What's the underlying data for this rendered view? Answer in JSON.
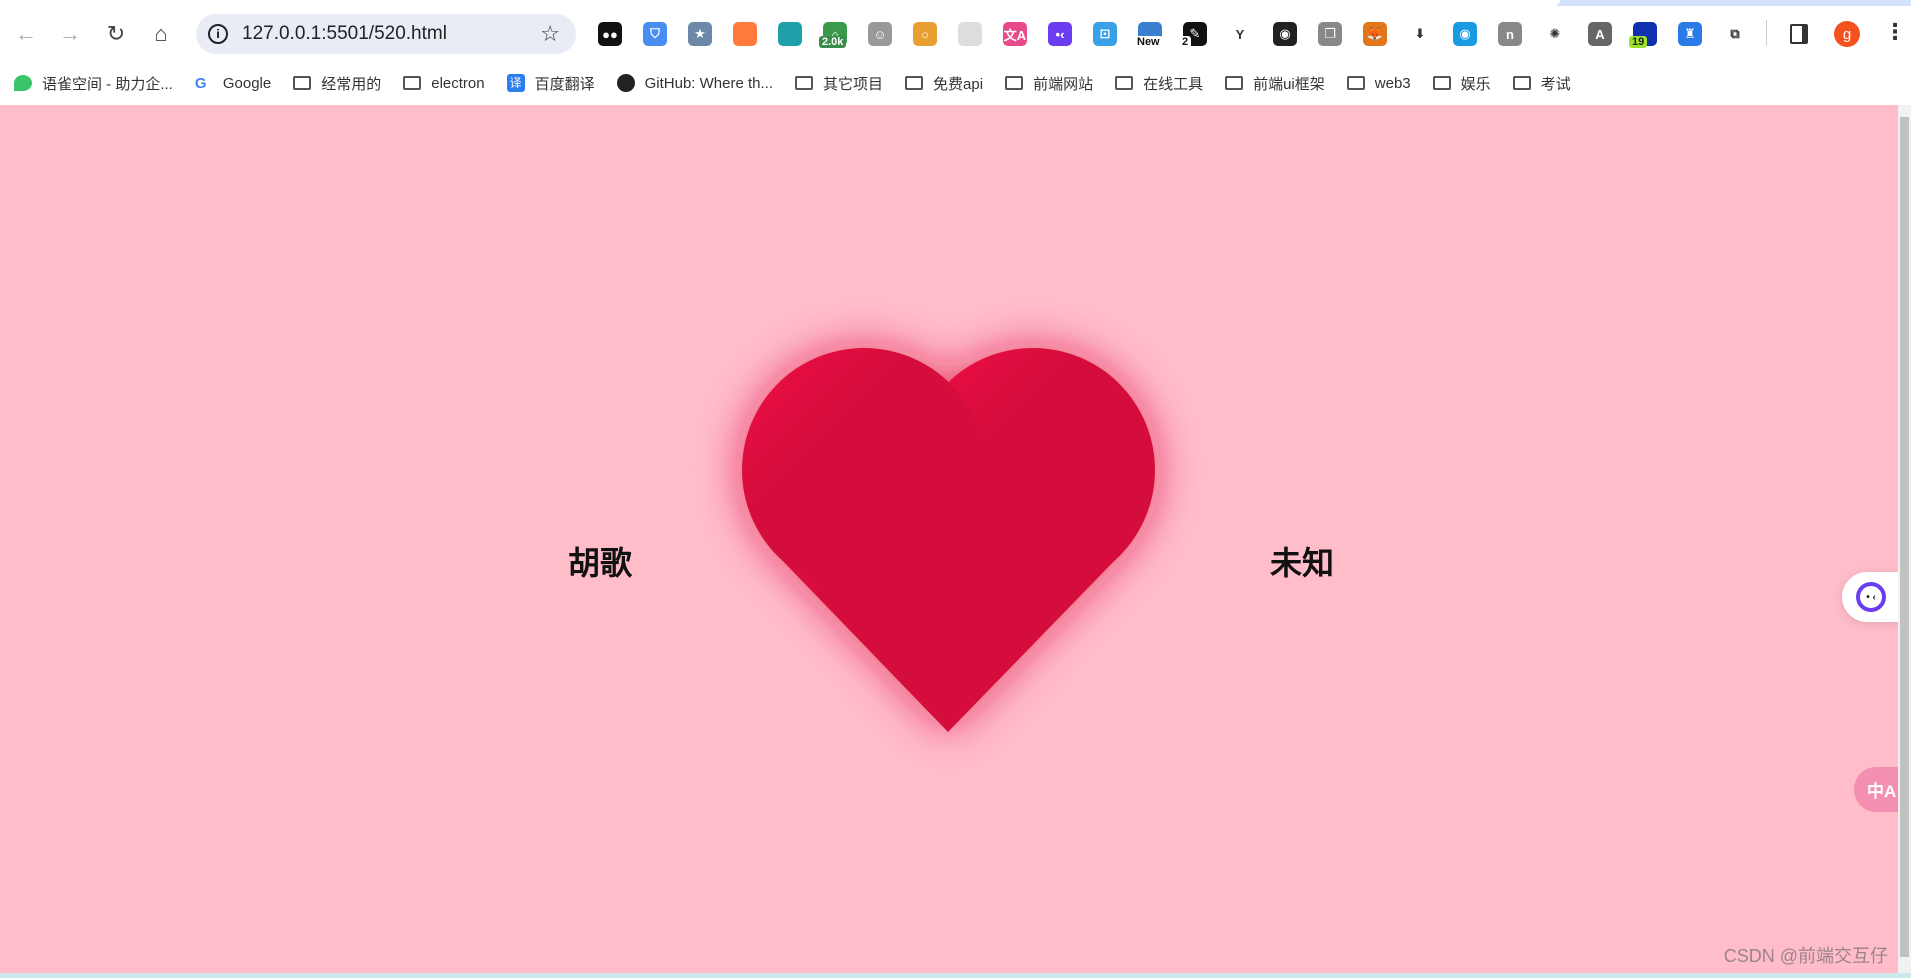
{
  "browser": {
    "url": "127.0.0.1:5501/520.html",
    "nav": {
      "back": "←",
      "forward": "→",
      "reload": "↻",
      "home": "⌂"
    },
    "extensions": [
      {
        "name": "tampermonkey-icon",
        "color": "#111",
        "glyph": "●●"
      },
      {
        "name": "shield-icon",
        "color": "#4a8df0",
        "glyph": "⛉"
      },
      {
        "name": "bookmark-star-icon",
        "color": "#6b88a8",
        "glyph": "★"
      },
      {
        "name": "orange-app-icon",
        "color": "#ff7a3d",
        "glyph": ""
      },
      {
        "name": "bowl-icon",
        "color": "#1fa0a8",
        "glyph": ""
      },
      {
        "name": "lock-counter-icon",
        "color": "#3a9a4a",
        "glyph": "⌂",
        "badge": "2.0k"
      },
      {
        "name": "face-icon",
        "color": "#999",
        "glyph": "☺"
      },
      {
        "name": "chrome-ring-icon",
        "color": "#e8a030",
        "glyph": "○"
      },
      {
        "name": "grid-icon",
        "color": "#ddd",
        "glyph": ""
      },
      {
        "name": "translate-pink-icon",
        "color": "#e84a8a",
        "glyph": "文A"
      },
      {
        "name": "monica-face-icon",
        "color": "#6a3df0",
        "glyph": "•‹"
      },
      {
        "name": "screenshot-icon",
        "color": "#3aa0e8",
        "glyph": "⊡"
      },
      {
        "name": "new-extension-icon",
        "color": "#3a7fd0",
        "glyph": "",
        "badge": "New"
      },
      {
        "name": "pen-icon",
        "color": "#111",
        "glyph": "✎",
        "badge": "2"
      },
      {
        "name": "y-icon",
        "color": "#fff",
        "glyph": "Y"
      },
      {
        "name": "colorful-ring-icon",
        "color": "#222",
        "glyph": "◉"
      },
      {
        "name": "copy-icon",
        "color": "#888",
        "glyph": "❐"
      },
      {
        "name": "metamask-fox-icon",
        "color": "#e2761b",
        "glyph": "🦊"
      },
      {
        "name": "download-arrow-icon",
        "color": "#fff",
        "glyph": "⬇"
      },
      {
        "name": "eye-icon",
        "color": "#1a9ae0",
        "glyph": "◉"
      },
      {
        "name": "n-icon",
        "color": "#888",
        "glyph": "n"
      },
      {
        "name": "ribbon-icon",
        "color": "#fff",
        "glyph": "✺"
      },
      {
        "name": "a-icon",
        "color": "#666",
        "glyph": "A"
      },
      {
        "name": "blue-square-icon",
        "color": "#1030b0",
        "glyph": "",
        "badge": "19"
      },
      {
        "name": "person-icon",
        "color": "#2a7ae8",
        "glyph": "♜"
      },
      {
        "name": "puzzle-extensions-icon",
        "color": "#fff",
        "glyph": "⧉"
      }
    ],
    "profile_initial": "g",
    "menu": "⋮"
  },
  "bookmarks": [
    {
      "label": "语雀空间 - 助力企...",
      "icon": "yuque-icon"
    },
    {
      "label": "Google",
      "icon": "google-icon"
    },
    {
      "label": "经常用的",
      "icon": "folder-icon"
    },
    {
      "label": "electron",
      "icon": "folder-icon"
    },
    {
      "label": "百度翻译",
      "icon": "baidu-translate-icon"
    },
    {
      "label": "GitHub: Where th...",
      "icon": "github-icon"
    },
    {
      "label": "其它项目",
      "icon": "folder-icon"
    },
    {
      "label": "免费api",
      "icon": "folder-icon"
    },
    {
      "label": "前端网站",
      "icon": "folder-icon"
    },
    {
      "label": "在线工具",
      "icon": "folder-icon"
    },
    {
      "label": "前端ui框架",
      "icon": "folder-icon"
    },
    {
      "label": "web3",
      "icon": "folder-icon"
    },
    {
      "label": "娱乐",
      "icon": "folder-icon"
    },
    {
      "label": "考试",
      "icon": "folder-icon"
    }
  ],
  "page": {
    "background": "#ffbdca",
    "left_name": "胡歌",
    "right_name": "未知",
    "heart_colors": [
      "#f20c46",
      "#d40a3c"
    ],
    "translate_widget": "中A",
    "watermark": "CSDN @前端交互仔"
  }
}
